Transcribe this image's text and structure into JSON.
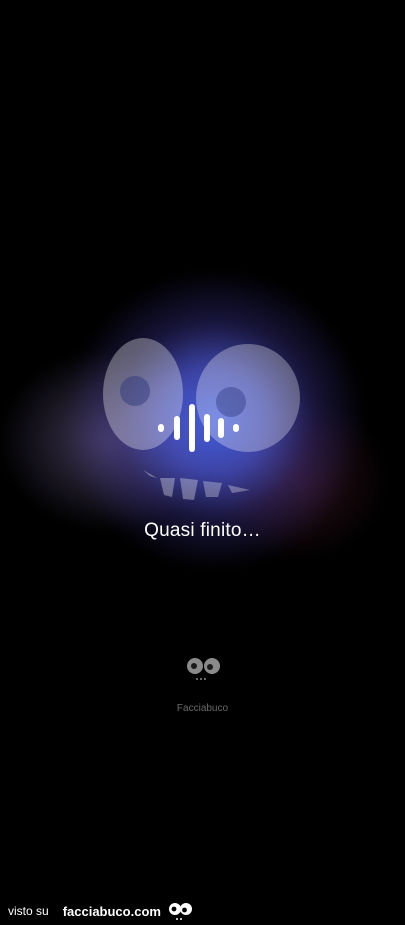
{
  "screen": {
    "status_text": "Quasi finito…",
    "app_name": "Facciabuco",
    "icons": {
      "voice": "voice-waveform-icon",
      "face": "facciabuco-face-icon"
    }
  },
  "footer": {
    "prefix": "visto su",
    "site": "facciabuco.com"
  },
  "colors": {
    "background": "#000000",
    "glow": "#4a64eb",
    "text": "#ffffff",
    "muted_text": "#6a6a6a"
  }
}
